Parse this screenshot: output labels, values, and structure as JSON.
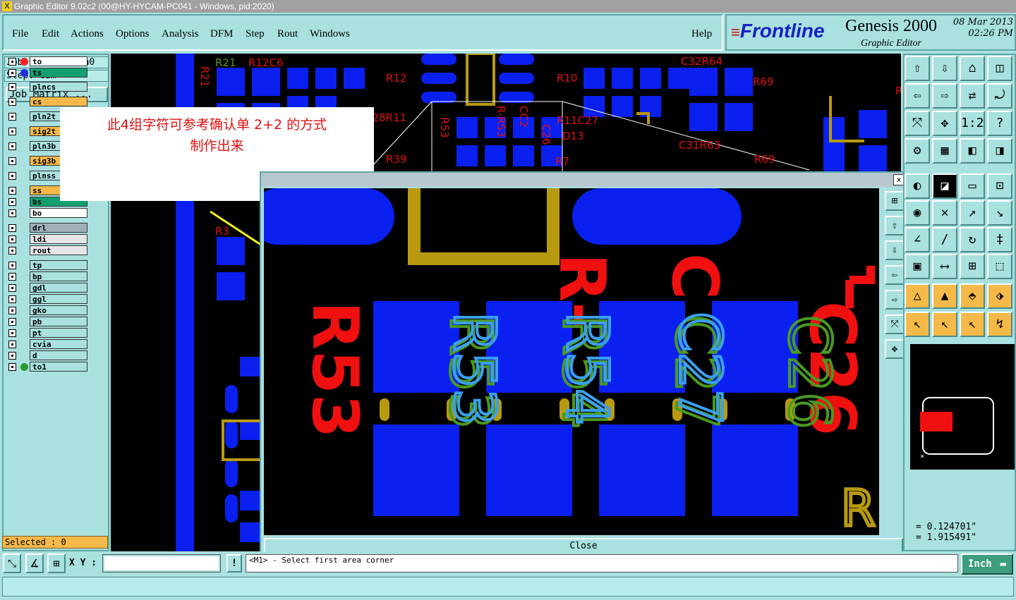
{
  "window": {
    "title": "Graphic Editor 9.02c2 (00@HY-HYCAM-PC041 - Windows, pid:2020)",
    "close_glyph": "×"
  },
  "menu": [
    "File",
    "Edit",
    "Actions",
    "Options",
    "Analysis",
    "DFM",
    "Step",
    "Rout",
    "Windows"
  ],
  "help": "Help",
  "brand": {
    "logo": "Frontline",
    "product": "Genesis 2000",
    "subtitle": "Graphic Editor",
    "date": "08 Mar 2013",
    "time": "02:26 PM"
  },
  "job": {
    "job": "Job : 4aa8k00ca0",
    "step": "Step: cam",
    "matrix_button": "Job Matrix ..."
  },
  "layers": [
    {
      "name": "to",
      "color": "#ffffff",
      "dot": "#ff2020"
    },
    {
      "name": "ts",
      "color": "#12a070",
      "dot": "#1a30e0"
    },
    {
      "name": "plncs",
      "color": "#a9e0e0",
      "dot": ""
    },
    {
      "name": "cs",
      "color": "#f5b949",
      "dot": ""
    },
    {
      "name": "pln2t",
      "color": "#a9e0e0",
      "dot": ""
    },
    {
      "name": "sig2t",
      "color": "#f5b949",
      "dot": ""
    },
    {
      "name": "pln3b",
      "color": "#a9e0e0",
      "dot": ""
    },
    {
      "name": "sig3b",
      "color": "#f5b949",
      "dot": ""
    },
    {
      "name": "plnss",
      "color": "#a9e0e0",
      "dot": ""
    },
    {
      "name": "ss",
      "color": "#f5b949",
      "dot": ""
    },
    {
      "name": "bs",
      "color": "#12a070",
      "dot": ""
    },
    {
      "name": "bo",
      "color": "#ffffff",
      "dot": ""
    },
    {
      "name": "drl",
      "color": "#a0b0b8",
      "dot": ""
    },
    {
      "name": "ldi",
      "color": "#e6e6e6",
      "dot": ""
    },
    {
      "name": "rout",
      "color": "#e6e6e6",
      "dot": ""
    },
    {
      "name": "tp",
      "color": "#a9e0e0",
      "dot": ""
    },
    {
      "name": "bp",
      "color": "#a9e0e0",
      "dot": ""
    },
    {
      "name": "gdl",
      "color": "#a9e0e0",
      "dot": ""
    },
    {
      "name": "ggl",
      "color": "#a9e0e0",
      "dot": ""
    },
    {
      "name": "gko",
      "color": "#a9e0e0",
      "dot": ""
    },
    {
      "name": "pb",
      "color": "#a9e0e0",
      "dot": ""
    },
    {
      "name": "pt",
      "color": "#a9e0e0",
      "dot": ""
    },
    {
      "name": "cvia",
      "color": "#a9e0e0",
      "dot": ""
    },
    {
      "name": "d",
      "color": "#a9e0e0",
      "dot": ""
    },
    {
      "name": "to1",
      "color": "#a9e0e0",
      "dot": "#2a9a2a"
    }
  ],
  "selected": "Selected : 0",
  "annotation": "此4组字符可参考确认单 2+2 的方式\n制作出来",
  "board_labels": [
    "R21",
    "R12C6",
    "R12",
    "R10",
    "R69",
    "R53",
    "R-R53",
    "CC2",
    "C26",
    "R11C27",
    "D13",
    "R39",
    "R7",
    "R63",
    "R3",
    "C32R64",
    "C31R63",
    "C28R11"
  ],
  "magnifier": {
    "close": "Close",
    "labels_red": [
      "R53",
      "R-",
      "C",
      "C26"
    ],
    "labels_green": [
      "R53",
      "R54",
      "C27",
      "C26"
    ],
    "labels_blue": [
      "R53",
      "R54",
      "C27"
    ],
    "label_gold": "R"
  },
  "coords": {
    "x": "= 0.124701\"",
    "y": "= 1.915491\""
  },
  "bottom": {
    "xy_label": "X Y :",
    "xy_value": "",
    "prompt": "<M1> - Select first area corner",
    "units": "Inch"
  },
  "colors": {
    "pad_blue": "#0a20f0",
    "silk_red": "#f01010",
    "silk_green": "#4a9a20",
    "silk_lightblue": "#3aa0f0",
    "copper_gold": "#b89a10",
    "panel": "#a9e0e0"
  },
  "tool_icons": [
    "page-up-icon",
    "page-down-icon",
    "home-icon",
    "window-icon",
    "page-left-icon",
    "page-right-icon",
    "mirror-icon",
    "rotate-icon",
    "fit-icon",
    "center-icon",
    "scale-icon",
    "help-icon",
    "measure-icon",
    "grid-icon",
    "snap-icon",
    "snap2-icon"
  ]
}
